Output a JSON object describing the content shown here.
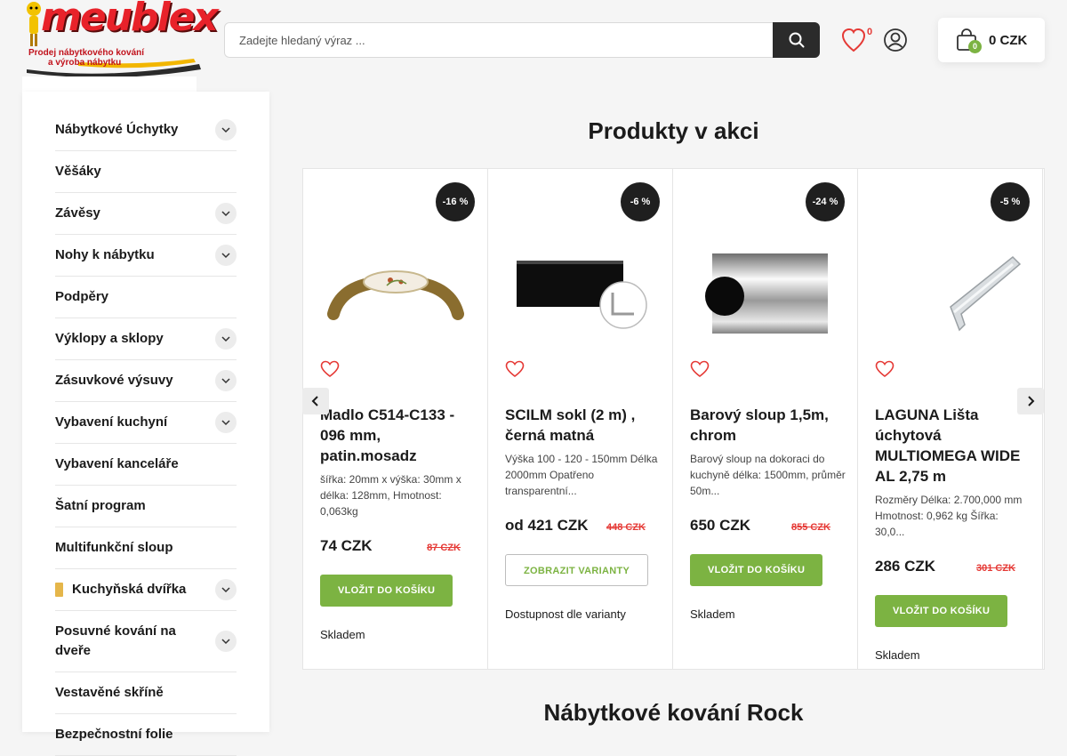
{
  "brand": {
    "name": "meublex",
    "tagline_1": "Prodej nábytkového kování",
    "tagline_2": "a výroba nábytku"
  },
  "search": {
    "placeholder": "Zadejte hledaný výraz ..."
  },
  "header": {
    "wishlist_count": "0",
    "cart_count": "0",
    "cart_total": "0 CZK"
  },
  "sidebar": {
    "items": [
      {
        "label": "Nábytkové Úchytky",
        "has_children": true
      },
      {
        "label": "Věšáky",
        "has_children": false
      },
      {
        "label": "Závěsy",
        "has_children": true
      },
      {
        "label": "Nohy k nábytku",
        "has_children": true
      },
      {
        "label": "Podpěry",
        "has_children": false
      },
      {
        "label": "Výklopy a sklopy",
        "has_children": true
      },
      {
        "label": "Zásuvkové výsuvy",
        "has_children": true
      },
      {
        "label": "Vybavení kuchyní",
        "has_children": true
      },
      {
        "label": "Vybavení kanceláře",
        "has_children": false
      },
      {
        "label": "Šatní program",
        "has_children": false
      },
      {
        "label": "Multifunkční sloup",
        "has_children": false
      },
      {
        "label": "Kuchyňská dvířka",
        "has_children": true
      },
      {
        "label": "Posuvné kování na dveře",
        "has_children": true
      },
      {
        "label": "Vestavěné skříně",
        "has_children": false
      },
      {
        "label": "Bezpečnostní folie",
        "has_children": false
      }
    ]
  },
  "main": {
    "section_title": "Produkty v akci",
    "next_section_title": "Nábytkové kování Rock",
    "products": [
      {
        "discount": "-16 %",
        "name": "Madlo C514-C133 - 096 mm, patin.mosadz",
        "description": "šířka: 20mm x výška: 30mm x délka: 128mm, Hmotnost: 0,063kg",
        "price": "74 CZK",
        "old_price": "87 CZK",
        "button": "VLOŽIT DO KOŠÍKU",
        "availability": "Skladem"
      },
      {
        "discount": "-6 %",
        "name": "SCILM sokl (2 m) , černá matná",
        "description": "Výška 100 - 120 - 150mm Délka 2000mm Opatřeno transparentní...",
        "price": "od 421 CZK",
        "old_price": "448 CZK",
        "button": "ZOBRAZIT VARIANTY",
        "availability": "Dostupnost dle varianty"
      },
      {
        "discount": "-24 %",
        "name": "Barový sloup 1,5m, chrom",
        "description": "Barový sloup na dokoraci do kuchyně délka: 1500mm, průměr 50m...",
        "price": "650 CZK",
        "old_price": "855 CZK",
        "button": "VLOŽIT DO KOŠÍKU",
        "availability": "Skladem"
      },
      {
        "discount": "-5 %",
        "name": "LAGUNA Lišta úchytová MULTIOMEGA WIDE AL 2,75 m",
        "description": "Rozměry Délka: 2.700,000 mm Hmotnost: 0,962 kg Šířka: 30,0...",
        "price": "286 CZK",
        "old_price": "301 CZK",
        "button": "VLOŽIT DO KOŠÍKU",
        "availability": "Skladem"
      }
    ]
  },
  "colors": {
    "accent_green": "#7cb342",
    "price_red": "#e53935",
    "brand_red": "#e8222a"
  }
}
